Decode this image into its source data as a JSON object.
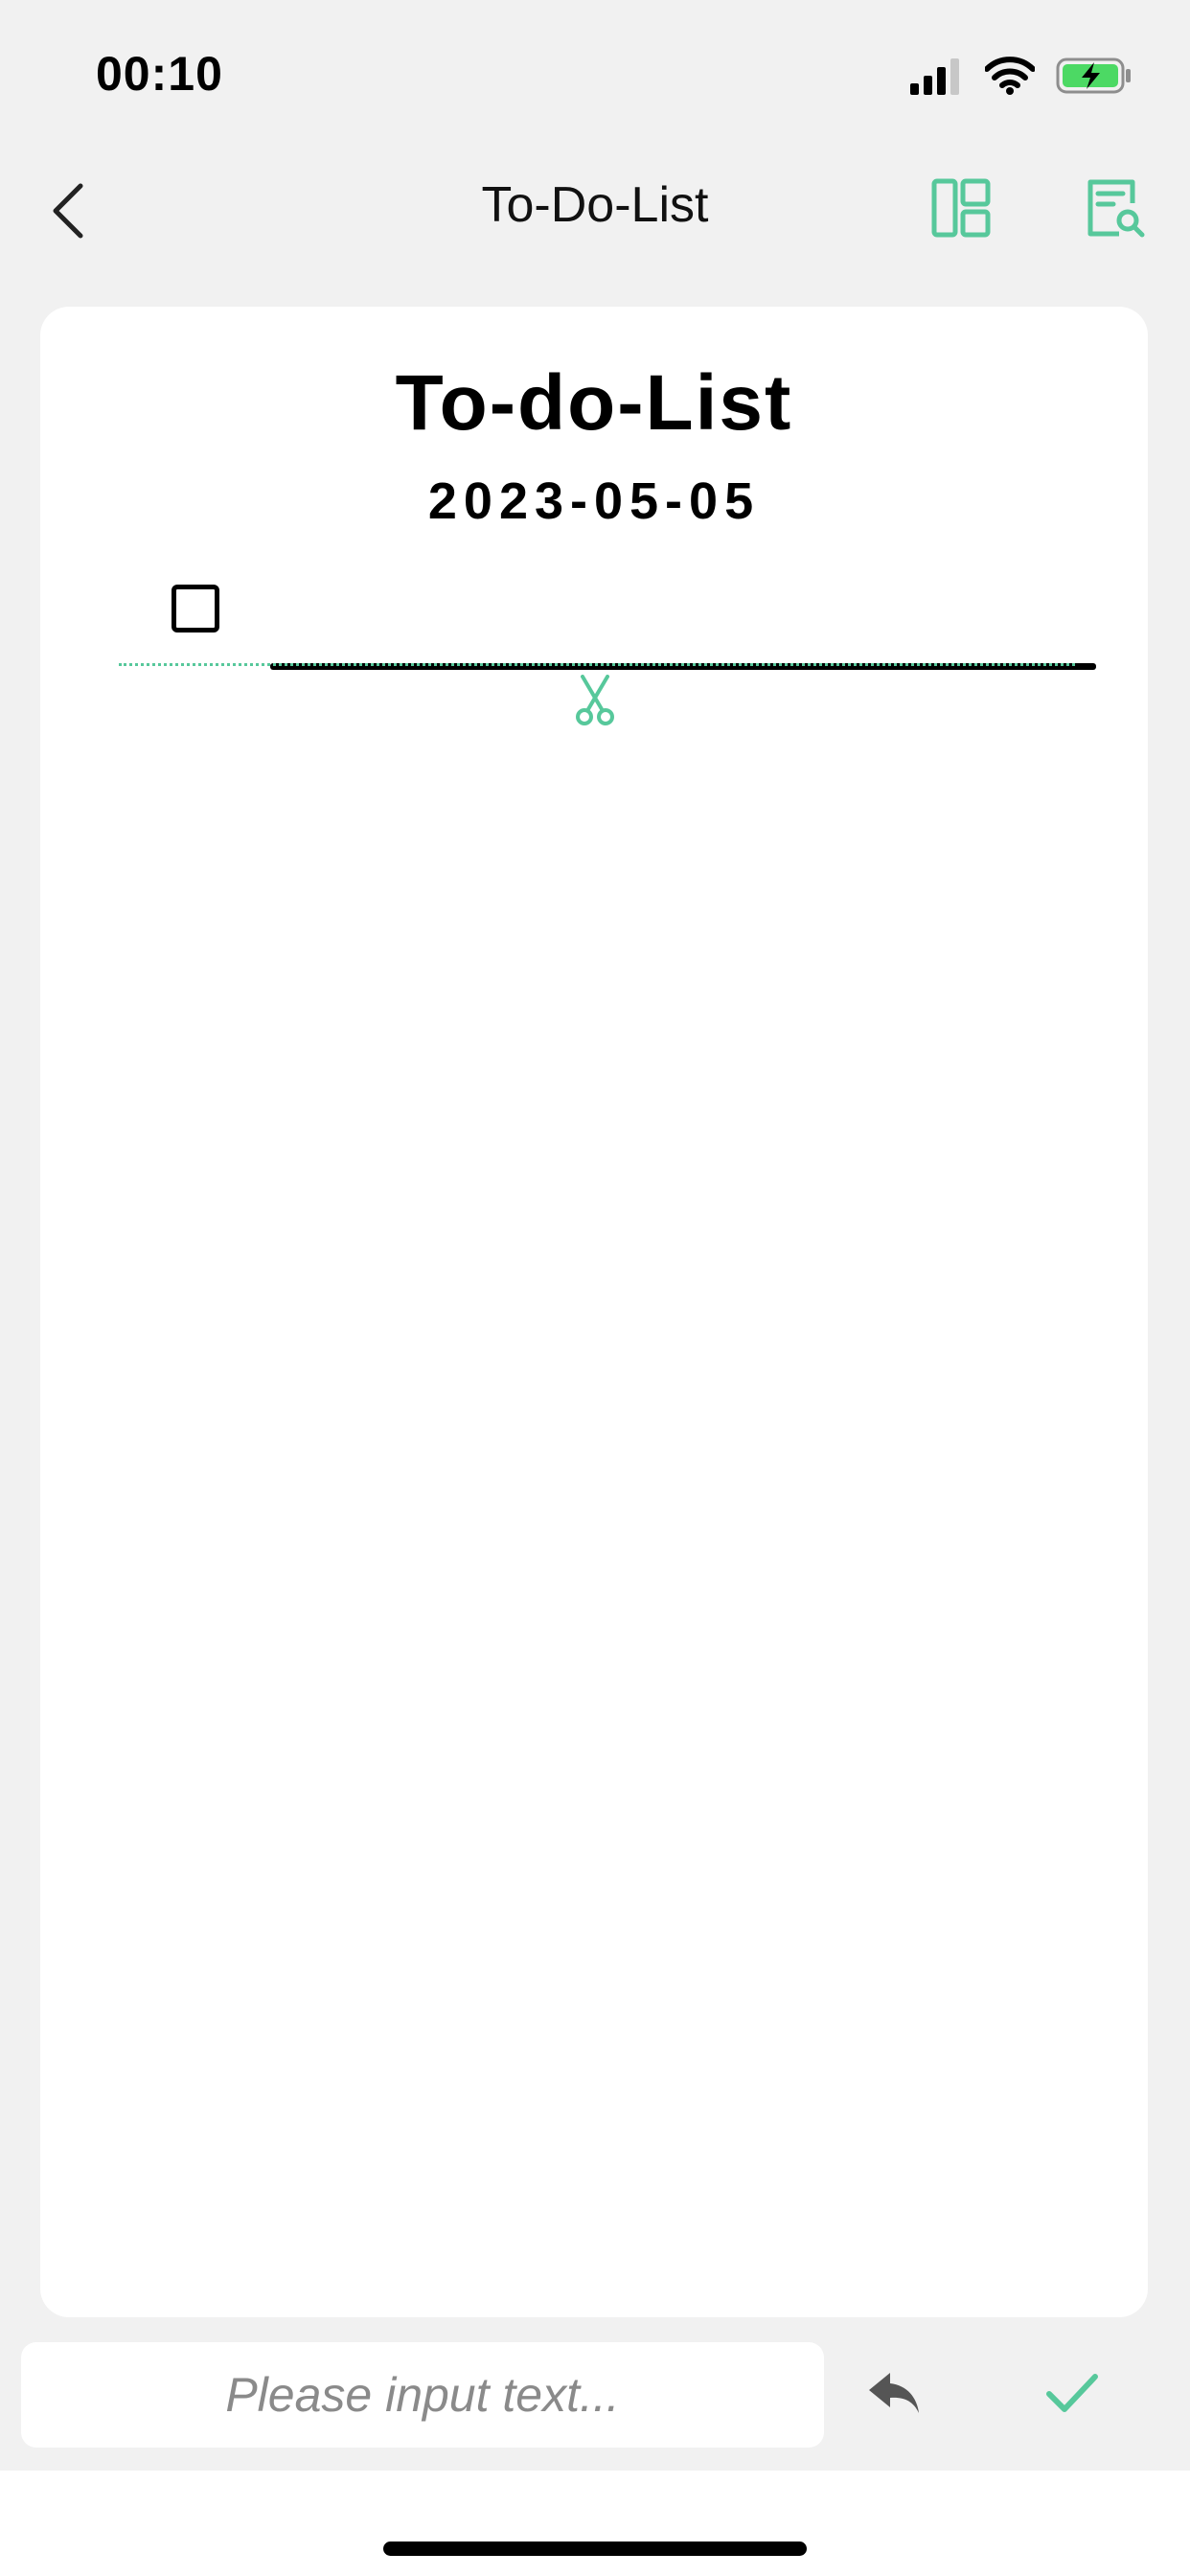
{
  "status_bar": {
    "time": "00:10",
    "icons": [
      "cellular-signal-icon",
      "wifi-icon",
      "battery-charging-icon"
    ]
  },
  "nav": {
    "title": "To-Do-List",
    "back_icon": "chevron-left-icon",
    "layout_icon": "layout-icon",
    "search_doc_icon": "document-search-icon"
  },
  "document": {
    "title": "To-do-List",
    "date": "2023-05-05",
    "items": [
      {
        "checked": false,
        "text": ""
      }
    ],
    "cut_icon": "scissors-icon"
  },
  "input_bar": {
    "placeholder": "Please input text...",
    "value": "",
    "undo_icon": "undo-icon",
    "confirm_icon": "checkmark-icon"
  },
  "colors": {
    "accent": "#57c89b",
    "background": "#f1f1f1",
    "card": "#ffffff",
    "battery": "#4cd964"
  }
}
